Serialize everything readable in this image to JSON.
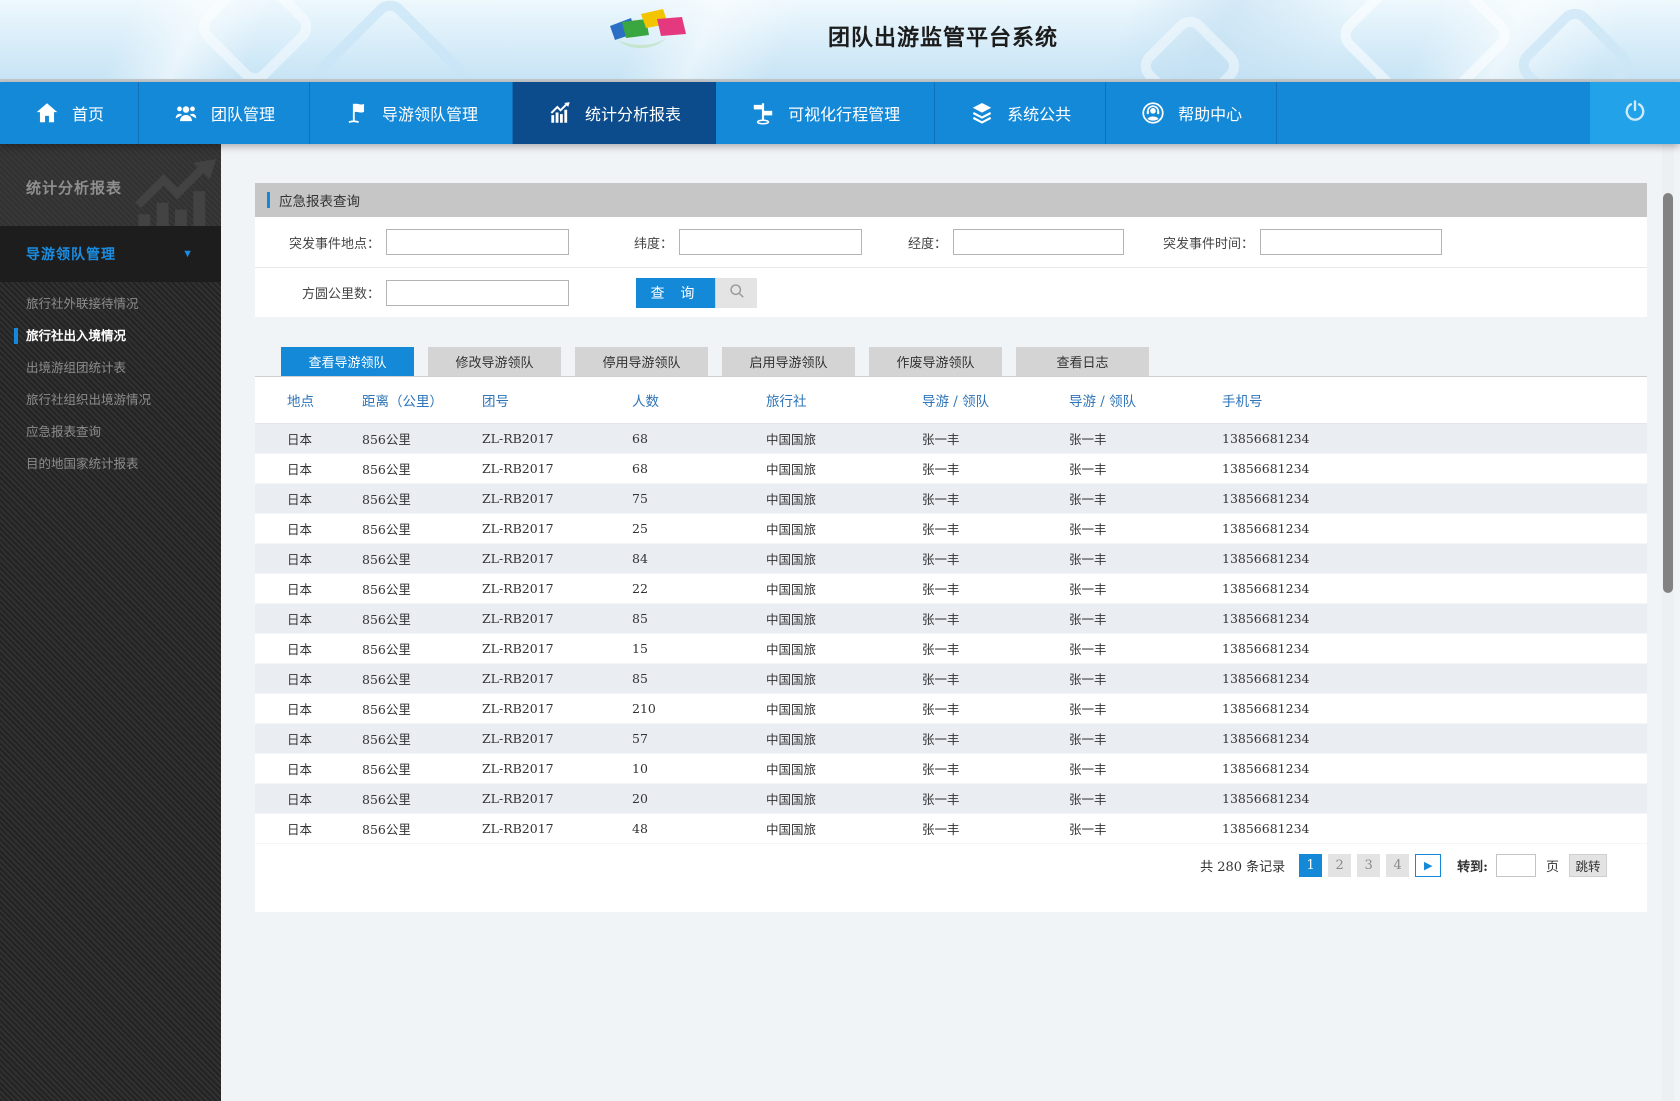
{
  "app": {
    "title": "团队出游监管平台系统"
  },
  "nav": {
    "items": [
      {
        "label": "首页",
        "icon": "home-icon",
        "active": false
      },
      {
        "label": "团队管理",
        "icon": "team-icon",
        "active": false
      },
      {
        "label": "导游领队管理",
        "icon": "guide-flag-icon",
        "active": false
      },
      {
        "label": "统计分析报表",
        "icon": "chart-icon",
        "active": true
      },
      {
        "label": "可视化行程管理",
        "icon": "signpost-icon",
        "active": false
      },
      {
        "label": "系统公共",
        "icon": "layers-icon",
        "active": false
      },
      {
        "label": "帮助中心",
        "icon": "headset-icon",
        "active": false
      }
    ]
  },
  "sidebar": {
    "title": "统计分析报表",
    "group": {
      "label": "导游领队管理",
      "arrow": "▼"
    },
    "items": [
      {
        "label": "旅行社外联接待情况",
        "active": false
      },
      {
        "label": "旅行社出入境情况",
        "active": true
      },
      {
        "label": "出境游组团统计表",
        "active": false
      },
      {
        "label": "旅行社组织出境游情况",
        "active": false
      },
      {
        "label": "应急报表查询",
        "active": false
      },
      {
        "label": "目的地国家统计报表",
        "active": false
      }
    ]
  },
  "search_panel": {
    "title": "应急报表查询",
    "fields": {
      "location_label": "突发事件地点：",
      "latitude_label": "纬度：",
      "longitude_label": "经度：",
      "time_label": "突发事件时间：",
      "radius_label": "方圆公里数：",
      "location_value": "",
      "latitude_value": "",
      "longitude_value": "",
      "time_value": "",
      "radius_value": ""
    },
    "query_button": "查 询"
  },
  "tabs": [
    {
      "label": "查看导游领队",
      "active": true
    },
    {
      "label": "修改导游领队",
      "active": false
    },
    {
      "label": "停用导游领队",
      "active": false
    },
    {
      "label": "启用导游领队",
      "active": false
    },
    {
      "label": "作废导游领队",
      "active": false
    },
    {
      "label": "查看日志",
      "active": false
    }
  ],
  "table": {
    "columns": [
      "地点",
      "距离（公里）",
      "团号",
      "人数",
      "旅行社",
      "导游 / 领队",
      "导游 / 领队",
      "手机号"
    ],
    "rows": [
      {
        "place": "日本",
        "distance": "856公里",
        "group_no": "ZL-RB2017",
        "people": "68",
        "agency": "中国国旅",
        "guide": "张一丰",
        "leader": "张一丰",
        "phone": "13856681234"
      },
      {
        "place": "日本",
        "distance": "856公里",
        "group_no": "ZL-RB2017",
        "people": "68",
        "agency": "中国国旅",
        "guide": "张一丰",
        "leader": "张一丰",
        "phone": "13856681234"
      },
      {
        "place": "日本",
        "distance": "856公里",
        "group_no": "ZL-RB2017",
        "people": "75",
        "agency": "中国国旅",
        "guide": "张一丰",
        "leader": "张一丰",
        "phone": "13856681234"
      },
      {
        "place": "日本",
        "distance": "856公里",
        "group_no": "ZL-RB2017",
        "people": "25",
        "agency": "中国国旅",
        "guide": "张一丰",
        "leader": "张一丰",
        "phone": "13856681234"
      },
      {
        "place": "日本",
        "distance": "856公里",
        "group_no": "ZL-RB2017",
        "people": "84",
        "agency": "中国国旅",
        "guide": "张一丰",
        "leader": "张一丰",
        "phone": "13856681234"
      },
      {
        "place": "日本",
        "distance": "856公里",
        "group_no": "ZL-RB2017",
        "people": "22",
        "agency": "中国国旅",
        "guide": "张一丰",
        "leader": "张一丰",
        "phone": "13856681234"
      },
      {
        "place": "日本",
        "distance": "856公里",
        "group_no": "ZL-RB2017",
        "people": "85",
        "agency": "中国国旅",
        "guide": "张一丰",
        "leader": "张一丰",
        "phone": "13856681234"
      },
      {
        "place": "日本",
        "distance": "856公里",
        "group_no": "ZL-RB2017",
        "people": "15",
        "agency": "中国国旅",
        "guide": "张一丰",
        "leader": "张一丰",
        "phone": "13856681234"
      },
      {
        "place": "日本",
        "distance": "856公里",
        "group_no": "ZL-RB2017",
        "people": "85",
        "agency": "中国国旅",
        "guide": "张一丰",
        "leader": "张一丰",
        "phone": "13856681234"
      },
      {
        "place": "日本",
        "distance": "856公里",
        "group_no": "ZL-RB2017",
        "people": "210",
        "agency": "中国国旅",
        "guide": "张一丰",
        "leader": "张一丰",
        "phone": "13856681234"
      },
      {
        "place": "日本",
        "distance": "856公里",
        "group_no": "ZL-RB2017",
        "people": "57",
        "agency": "中国国旅",
        "guide": "张一丰",
        "leader": "张一丰",
        "phone": "13856681234"
      },
      {
        "place": "日本",
        "distance": "856公里",
        "group_no": "ZL-RB2017",
        "people": "10",
        "agency": "中国国旅",
        "guide": "张一丰",
        "leader": "张一丰",
        "phone": "13856681234"
      },
      {
        "place": "日本",
        "distance": "856公里",
        "group_no": "ZL-RB2017",
        "people": "20",
        "agency": "中国国旅",
        "guide": "张一丰",
        "leader": "张一丰",
        "phone": "13856681234"
      },
      {
        "place": "日本",
        "distance": "856公里",
        "group_no": "ZL-RB2017",
        "people": "48",
        "agency": "中国国旅",
        "guide": "张一丰",
        "leader": "张一丰",
        "phone": "13856681234"
      }
    ]
  },
  "pagination": {
    "summary": "共 280 条记录",
    "pages": [
      {
        "label": "1",
        "active": true
      },
      {
        "label": "2",
        "active": false
      },
      {
        "label": "3",
        "active": false
      },
      {
        "label": "4",
        "active": false
      }
    ],
    "next_icon": "▶",
    "goto_label": "转到:",
    "page_input_value": "",
    "page_unit": "页",
    "jump_button": "跳转"
  },
  "colors": {
    "nav_blue": "#1489d8",
    "nav_active": "#0c4c8c",
    "power_blue": "#22a2e8",
    "accent_blue": "#1489d8",
    "sidebar_bg": "#2d2d2d",
    "panel_header_gray": "#c6c6c6",
    "row_stripe": "#eaeef3",
    "table_header_text": "#2e74b8"
  }
}
